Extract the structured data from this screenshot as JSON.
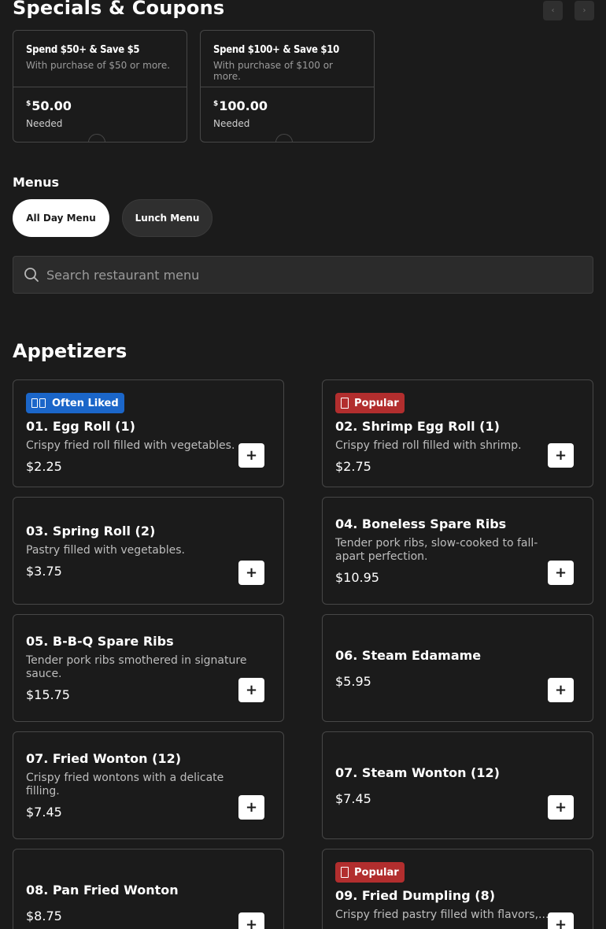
{
  "specials": {
    "title": "Specials & Coupons",
    "prev_icon": "‹",
    "next_icon": "›",
    "coupons": [
      {
        "title": "Spend $50+ & Save $5",
        "subtitle": "With purchase of $50 or more.",
        "currency": "$",
        "amount": "50.00",
        "needed": "Needed"
      },
      {
        "title": "Spend $100+ & Save $10",
        "subtitle": "With purchase of $100 or more.",
        "currency": "$",
        "amount": "100.00",
        "needed": "Needed"
      }
    ]
  },
  "menus": {
    "label": "Menus",
    "tabs": [
      {
        "label": "All Day Menu",
        "active": true
      },
      {
        "label": "Lunch Menu",
        "active": false
      }
    ]
  },
  "search": {
    "placeholder": "Search restaurant menu",
    "icon": "search-icon"
  },
  "section": {
    "title": "Appetizers"
  },
  "items": [
    {
      "badge": "Often Liked",
      "name": "01. Egg Roll (1)",
      "desc": "Crispy fried roll filled with vegetables.",
      "price": "$2.25"
    },
    {
      "badge": "Popular",
      "name": "02. Shrimp Egg Roll (1)",
      "desc": "Crispy fried roll filled with shrimp.",
      "price": "$2.75"
    },
    {
      "name": "03. Spring Roll (2)",
      "desc": "Pastry filled with vegetables.",
      "price": "$3.75"
    },
    {
      "name": "04. Boneless Spare Ribs",
      "desc": "Tender pork ribs, slow-cooked to fall-apart perfection.",
      "price": "$10.95"
    },
    {
      "name": "05. B-B-Q Spare Ribs",
      "desc": "Tender pork ribs smothered in signature sauce.",
      "price": "$15.75"
    },
    {
      "name": "06. Steam Edamame",
      "price": "$5.95"
    },
    {
      "name": "07. Fried Wonton (12)",
      "desc": "Crispy fried wontons with a delicate filling.",
      "price": "$7.45"
    },
    {
      "name": "07. Steam Wonton (12)",
      "price": "$7.45"
    },
    {
      "name": "08. Pan Fried Wonton",
      "price": "$8.75"
    },
    {
      "badge": "Popular",
      "name": "09. Fried Dumpling (8)",
      "desc": "Crispy fried pastry filled with flavors,..."
    }
  ],
  "add_label": "+",
  "colors": {
    "background": "#1b1b1b",
    "often_liked": "#1b66c9",
    "popular": "#b22e2e"
  }
}
